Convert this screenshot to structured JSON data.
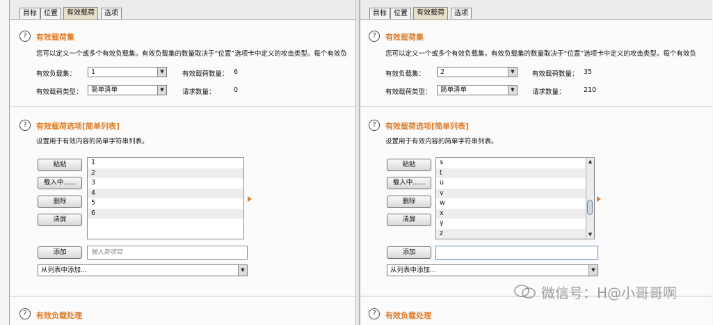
{
  "tabs": [
    "目标",
    "位置",
    "有效载荷",
    "选项"
  ],
  "payload_sets": {
    "title": "有效载荷集",
    "description": "您可以定义一个或多个有效负载集。有效负载集的数量取决于“位置”选项卡中定义的攻击类型。每个有效负",
    "payload_set_label": "有效负载集：",
    "payload_type_label": "有效载荷类型：",
    "payload_count_label": "有效载荷数量：",
    "request_count_label": "请求数量："
  },
  "payload_options": {
    "title": "有效载荷选项[简单列表]",
    "description": "设置用于有效内容的简单字符串列表。",
    "paste": "粘贴",
    "load": "载入中......",
    "remove": "删除",
    "clear": "清屏",
    "add": "添加",
    "add_placeholder": "输入新项目",
    "add_from_list": "从列表中添加..."
  },
  "processing_title": "有效负载处理",
  "left": {
    "payload_set": "1",
    "payload_type": "简单清单",
    "payload_count": "6",
    "request_count": "0",
    "list_items": [
      "1",
      "2",
      "3",
      "4",
      "5",
      "6"
    ]
  },
  "right": {
    "payload_set": "2",
    "payload_type": "简单清单",
    "payload_count": "35",
    "request_count": "210",
    "list_items": [
      "s",
      "t",
      "u",
      "v",
      "w",
      "x",
      "y",
      "z"
    ]
  },
  "watermark": "微信号：H@小哥哥啊",
  "colors": {
    "accent": "#e07b26",
    "active_tab": "#e6e0c8"
  },
  "icons": {
    "help": "help-circle-icon",
    "dropdown": "chevron-down-icon",
    "marker": "triangle-right-icon"
  }
}
